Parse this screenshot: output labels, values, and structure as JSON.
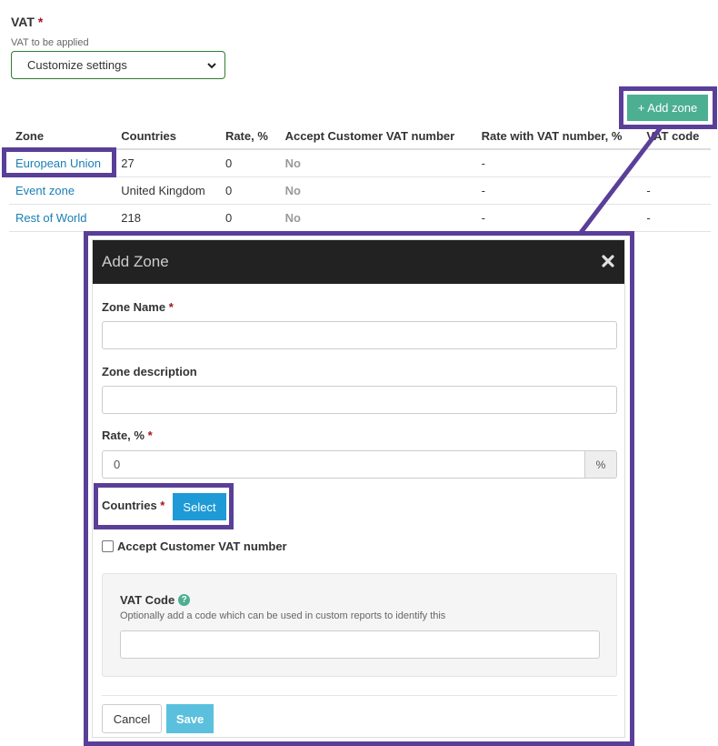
{
  "vat": {
    "label": "VAT",
    "required_mark": "*",
    "help": "VAT to be applied",
    "selected": "Customize settings"
  },
  "toolbar": {
    "add_zone_label": "+ Add zone"
  },
  "table": {
    "headers": [
      "Zone",
      "Countries",
      "Rate, %",
      "Accept Customer VAT number",
      "Rate with VAT number, %",
      "VAT code"
    ],
    "rows": [
      {
        "zone": "European Union",
        "countries": "27",
        "rate": "0",
        "accept": "No",
        "rate_vat": "-",
        "vat_code": ""
      },
      {
        "zone": "Event zone",
        "countries": "United Kingdom",
        "rate": "0",
        "accept": "No",
        "rate_vat": "-",
        "vat_code": "-"
      },
      {
        "zone": "Rest of World",
        "countries": "218",
        "rate": "0",
        "accept": "No",
        "rate_vat": "-",
        "vat_code": "-"
      }
    ]
  },
  "modal": {
    "title": "Add Zone",
    "zone_name_label": "Zone Name",
    "zone_name_value": "",
    "zone_desc_label": "Zone description",
    "zone_desc_value": "",
    "rate_label": "Rate, %",
    "rate_value": "0",
    "rate_addon": "%",
    "countries_label": "Countries",
    "select_label": "Select",
    "accept_label": "Accept Customer VAT number",
    "vat_code_label": "VAT Code",
    "vat_code_help": "Optionally add a code which can be used in custom reports to identify this",
    "cancel_label": "Cancel",
    "save_label": "Save"
  },
  "colors": {
    "accent_green": "#4caf92",
    "primary_blue": "#1e9ad6",
    "highlight": "#5a3f99",
    "link": "#1a7fb5"
  },
  "icons": [
    "chevron-down-icon",
    "close-icon",
    "help-icon"
  ]
}
